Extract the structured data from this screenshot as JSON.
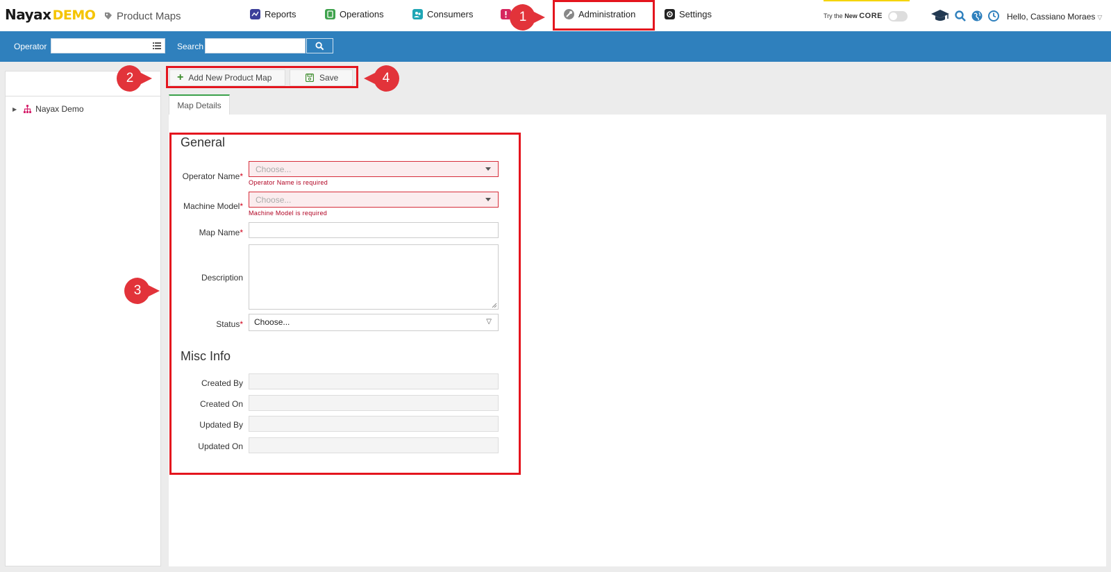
{
  "header": {
    "logo_brand": "Nayax",
    "logo_demo": "DEMO",
    "page_title": "Product Maps",
    "nav": [
      {
        "label": "Reports",
        "icon": "reports-chart-icon"
      },
      {
        "label": "Operations",
        "icon": "operations-icon"
      },
      {
        "label": "Consumers",
        "icon": "consumers-icon"
      },
      {
        "label": "",
        "icon": "alerts-icon"
      },
      {
        "label": "Administration",
        "icon": "administration-wrench-icon"
      },
      {
        "label": "Settings",
        "icon": "settings-gear-icon"
      }
    ],
    "try_core_prefix": "Try the",
    "try_core_new": "New",
    "try_core_core": "CORE",
    "greeting": "Hello, Cassiano Moraes"
  },
  "filterbar": {
    "operator_label": "Operator",
    "operator_value": "",
    "search_label": "Search",
    "search_value": ""
  },
  "tree": {
    "items": [
      {
        "label": "Nayax Demo"
      }
    ]
  },
  "toolbar": {
    "add_label": "Add New Product Map",
    "save_label": "Save"
  },
  "tabs": [
    {
      "label": "Map Details",
      "active": true
    }
  ],
  "form": {
    "general_title": "General",
    "operator_name": {
      "label": "Operator Name",
      "placeholder": "Choose...",
      "error": "Operator Name is required",
      "required": true
    },
    "machine_model": {
      "label": "Machine Model",
      "placeholder": "Choose...",
      "error": "Machine Model is required",
      "required": true
    },
    "map_name": {
      "label": "Map Name",
      "value": "",
      "required": true
    },
    "description": {
      "label": "Description",
      "value": ""
    },
    "status": {
      "label": "Status",
      "value": "Choose...",
      "required": true
    },
    "misc_title": "Misc Info",
    "created_by": {
      "label": "Created By",
      "value": ""
    },
    "created_on": {
      "label": "Created On",
      "value": ""
    },
    "updated_by": {
      "label": "Updated By",
      "value": ""
    },
    "updated_on": {
      "label": "Updated On",
      "value": ""
    }
  },
  "callouts": [
    "1",
    "2",
    "3",
    "4"
  ],
  "colors": {
    "brand_blue": "#2f80bd",
    "highlight_red": "#e4151e",
    "callout_red": "#e2333a",
    "demo_yellow": "#f5c400",
    "error_red": "#d62d3a",
    "tab_green": "#3aa14b"
  }
}
